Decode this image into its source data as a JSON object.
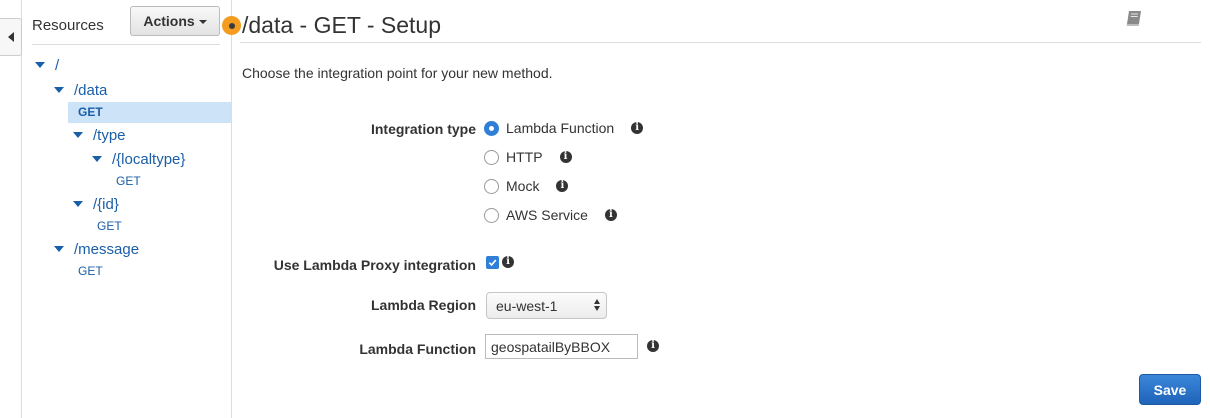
{
  "sidebar": {
    "title": "Resources",
    "actions_label": "Actions",
    "tree": [
      {
        "label": "/"
      },
      {
        "label": "/data"
      },
      {
        "label": "GET"
      },
      {
        "label": "/type"
      },
      {
        "label": "/{localtype}"
      },
      {
        "label": "GET"
      },
      {
        "label": "/{id}"
      },
      {
        "label": "GET"
      },
      {
        "label": "/message"
      },
      {
        "label": "GET"
      }
    ]
  },
  "main": {
    "title": "/data - GET - Setup",
    "intro": "Choose the integration point for your new method.",
    "integration_type": {
      "label": "Integration type",
      "options": [
        {
          "label": "Lambda Function",
          "checked": true
        },
        {
          "label": "HTTP",
          "checked": false
        },
        {
          "label": "Mock",
          "checked": false
        },
        {
          "label": "AWS Service",
          "checked": false
        }
      ]
    },
    "proxy": {
      "label": "Use Lambda Proxy integration",
      "checked": true
    },
    "region": {
      "label": "Lambda Region",
      "value": "eu-west-1"
    },
    "function": {
      "label": "Lambda Function",
      "value": "geospatailByBBOX"
    },
    "save_label": "Save"
  },
  "icons": {
    "collapse": "caret-left-icon",
    "docs": "book-icon",
    "info": "info-icon",
    "status": "orange-dot-icon"
  },
  "colors": {
    "accent": "#2f7fd8",
    "link": "#1a5ea8",
    "selection": "#cde3f7",
    "status": "#f39c1f",
    "save": "#1f64ba"
  }
}
